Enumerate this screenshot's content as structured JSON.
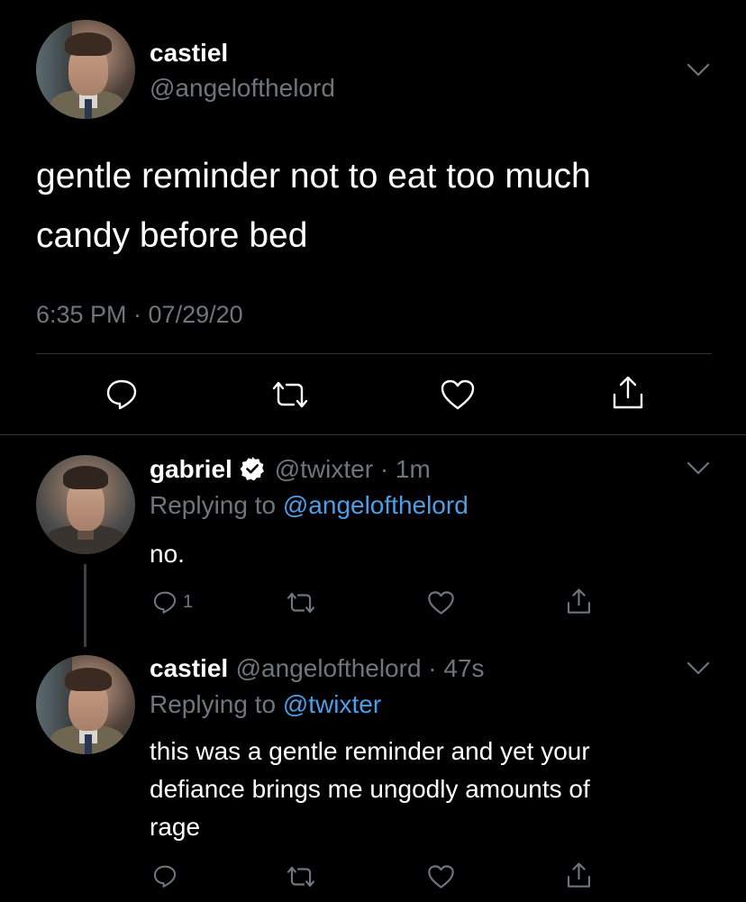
{
  "main_tweet": {
    "name": "castiel",
    "handle": "@angelofthelord",
    "text_line1": "gentle reminder not to eat too much",
    "text_line2": "candy before bed",
    "timestamp": "6:35 PM · 07/29/20"
  },
  "reply1": {
    "name": "gabriel",
    "verified": true,
    "handle_time": "@twixter · 1m",
    "replying_prefix": "Replying to",
    "replying_handle": "@angelofthelord",
    "text": "no.",
    "reply_count": "1"
  },
  "reply2": {
    "name": "castiel",
    "handle_time": "@angelofthelord · 47s",
    "replying_prefix": "Replying to",
    "replying_handle": "@twixter",
    "text_line1": "this was a gentle reminder and yet your",
    "text_line2": "defiance brings me ungodly amounts of",
    "text_line3": "rage"
  },
  "colors": {
    "background": "#000000",
    "text": "#ffffff",
    "secondary": "#6e767d",
    "link": "#4a9fe8",
    "divider": "#2f3336"
  }
}
